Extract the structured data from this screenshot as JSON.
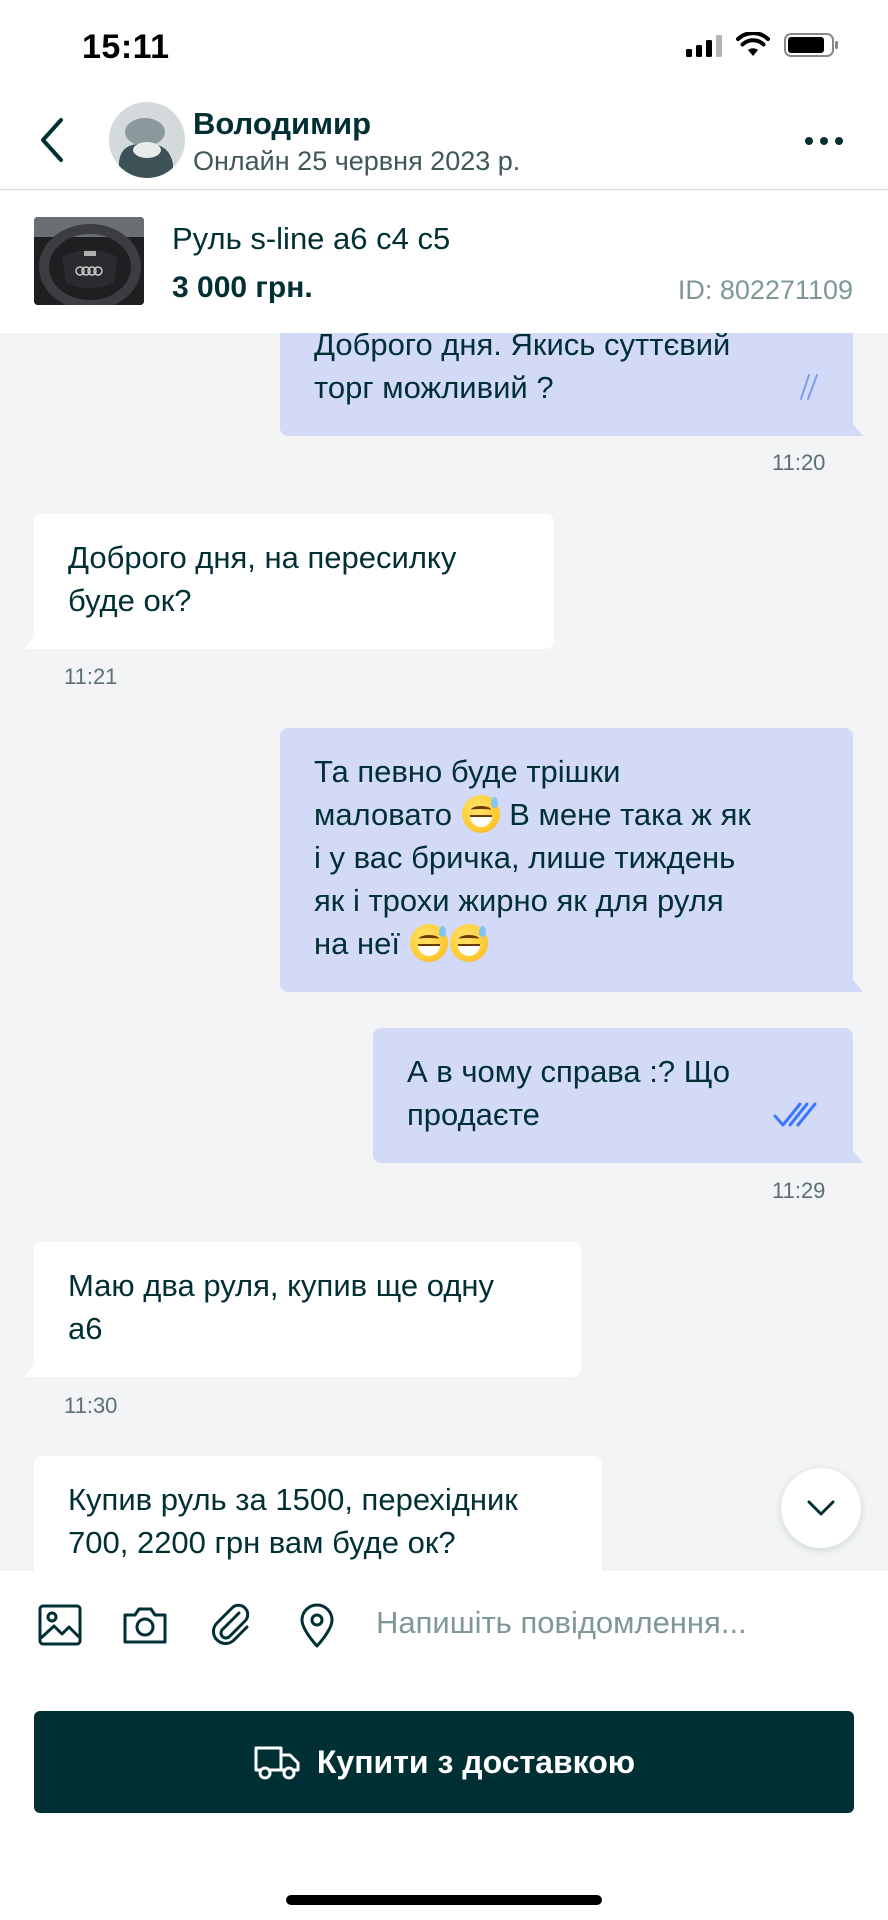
{
  "status_bar": {
    "time": "15:11"
  },
  "header": {
    "contact_name": "Володимир",
    "contact_status": "Онлайн 25 червня 2023 р."
  },
  "ad": {
    "title": "Руль s-line а6 с4 с5",
    "price": "3 000 грн.",
    "id": "ID: 802271109"
  },
  "messages": [
    {
      "dir": "out",
      "lines": [
        "Доброго дня. Якись суттєвий",
        "торг можливий ?"
      ],
      "time": "11:20",
      "read": true
    },
    {
      "dir": "in",
      "lines": [
        "Доброго дня, на пересилку",
        "буде ок?"
      ],
      "time": "11:21"
    },
    {
      "dir": "out",
      "lines": [
        "Та певно буде трішки",
        "маловато",
        "В мене така ж як",
        "і у вас бричка, лише тиждень",
        "як і трохи жирно як для руля",
        "на неї"
      ]
    },
    {
      "dir": "out",
      "lines": [
        "А в чому справа :? Що",
        "продаєте"
      ],
      "time": "11:29",
      "read": true
    },
    {
      "dir": "in",
      "lines": [
        "Маю два руля, купив ще одну",
        "а6"
      ],
      "time": "11:30"
    },
    {
      "dir": "in",
      "lines": [
        "Купив руль за 1500, перехідник",
        "700, 2200 грн вам буде ок?"
      ]
    }
  ],
  "composer": {
    "placeholder": "Напишіть повідомлення..."
  },
  "buy_button": {
    "label": "Купити з доставкою"
  },
  "colors": {
    "brand_dark": "#002f34",
    "outgoing_bubble": "#d2daf8",
    "incoming_bubble": "#ffffff",
    "read_ticks": "#3a77ff"
  }
}
